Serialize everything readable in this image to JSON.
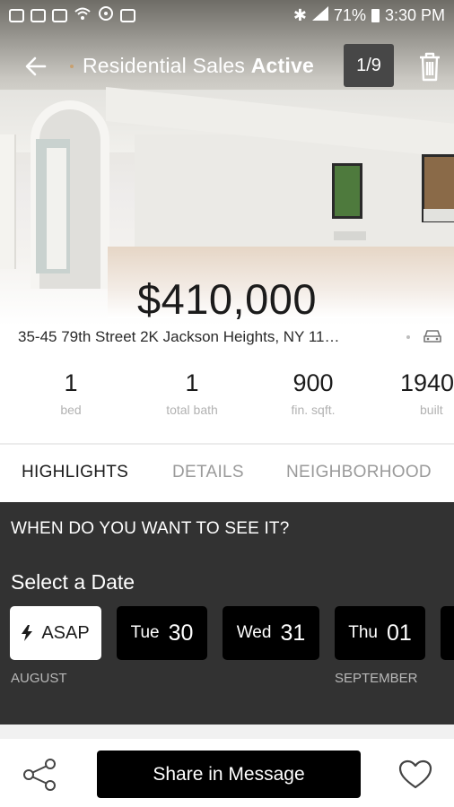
{
  "status_bar": {
    "battery": "71%",
    "time": "3:30 PM"
  },
  "app_bar": {
    "title_prefix": "Residential Sales",
    "title_status": "Active",
    "photo_counter": "1/9"
  },
  "listing": {
    "price": "$410,000",
    "address": "35-45 79th Street 2K Jackson Heights, NY 11…"
  },
  "stats": [
    {
      "value": "1",
      "label": "bed"
    },
    {
      "value": "1",
      "label": "total bath"
    },
    {
      "value": "900",
      "label": "fin. sqft."
    },
    {
      "value": "1940",
      "label": "built"
    }
  ],
  "tabs": [
    {
      "label": "HIGHLIGHTS",
      "active": true
    },
    {
      "label": "DETAILS",
      "active": false
    },
    {
      "label": "NEIGHBORHOOD",
      "active": false
    }
  ],
  "schedule": {
    "question": "WHEN DO YOU WANT TO SEE IT?",
    "heading": "Select a Date",
    "asap_label": "ASAP",
    "dates": [
      {
        "dow": "Tue",
        "day": "30"
      },
      {
        "dow": "Wed",
        "day": "31"
      },
      {
        "dow": "Thu",
        "day": "01"
      }
    ],
    "months": [
      "AUGUST",
      "SEPTEMBER"
    ]
  },
  "actions": {
    "share_label": "Share in Message"
  },
  "icons": [
    "back-arrow-icon",
    "trash-icon",
    "car-icon",
    "share-icon",
    "heart-icon",
    "bolt-icon"
  ]
}
